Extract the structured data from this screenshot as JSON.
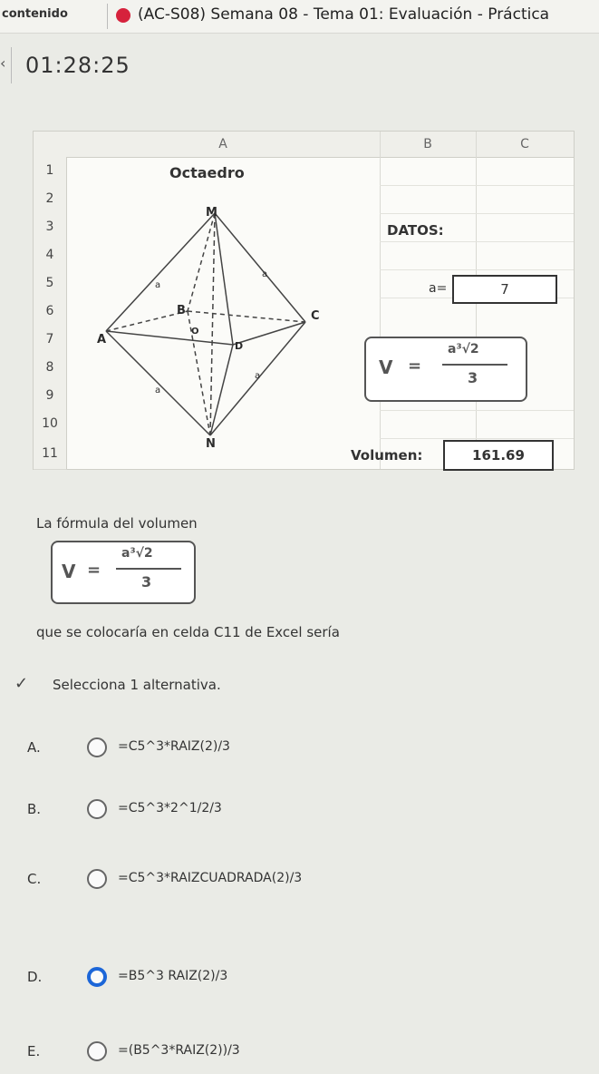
{
  "header": {
    "breadcrumb": "contenido",
    "exam_title": "(AC-S08) Semana 08 - Tema 01: Evaluación - Práctica",
    "timer": "01:28:25"
  },
  "spreadsheet": {
    "columns": [
      "A",
      "B",
      "C"
    ],
    "rows": [
      "1",
      "2",
      "3",
      "4",
      "5",
      "6",
      "7",
      "8",
      "9",
      "10",
      "11"
    ],
    "title_cell": "Octaedro",
    "datos_label": "DATOS:",
    "a_label": "a=",
    "a_value": "7",
    "volume_label": "Volumen:",
    "volume_value": "161.69",
    "diagram_labels": {
      "top": "M",
      "bottom": "N",
      "left": "A",
      "back": "B",
      "right": "C",
      "front": "D",
      "center": "O",
      "edge": "a"
    }
  },
  "formula": {
    "lhs": "V",
    "eq": "=",
    "numerator": "a³√2",
    "denominator": "3"
  },
  "question": {
    "intro": "La fórmula del volumen",
    "prompt": "que se colocaría en celda C11 de Excel sería",
    "instruction": "Selecciona 1 alternativa."
  },
  "options": [
    {
      "letter": "A.",
      "text": "=C5^3*RAIZ(2)/3",
      "selected": false
    },
    {
      "letter": "B.",
      "text": "=C5^3*2^1/2/3",
      "selected": false
    },
    {
      "letter": "C.",
      "text": "=C5^3*RAIZCUADRADA(2)/3",
      "selected": false
    },
    {
      "letter": "D.",
      "text": "=B5^3 RAIZ(2)/3",
      "selected": true
    },
    {
      "letter": "E.",
      "text": "=(B5^3*RAIZ(2))/3",
      "selected": false
    }
  ],
  "colors": {
    "record_dot": "#d6223c",
    "selected_radio": "#1c66d8"
  }
}
